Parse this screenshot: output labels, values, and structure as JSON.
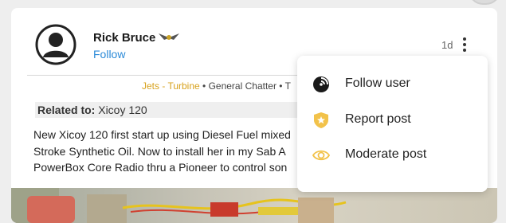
{
  "post": {
    "author_name": "Rick Bruce",
    "follow_label": "Follow",
    "age": "1d",
    "category_primary": "Jets - Turbine",
    "separator": " • ",
    "category_secondary": "General Chatter",
    "category_tertiary": "T",
    "related_label": "Related to:",
    "related_value": " Xicoy 120",
    "body_lines": [
      "New Xicoy 120 first start up using Diesel Fuel mixed",
      "Stroke Synthetic Oil. Now to install her in my Sab A",
      "PowerBox Core Radio thru a Pioneer to control son"
    ]
  },
  "menu": {
    "items": [
      {
        "label": "Follow user",
        "icon": "follow-user-icon"
      },
      {
        "label": "Report post",
        "icon": "shield-star-icon"
      },
      {
        "label": "Moderate post",
        "icon": "eye-icon"
      }
    ]
  },
  "colors": {
    "accent_link": "#2b8ad8",
    "category": "#d8a21d",
    "shield": "#f2c24a"
  }
}
